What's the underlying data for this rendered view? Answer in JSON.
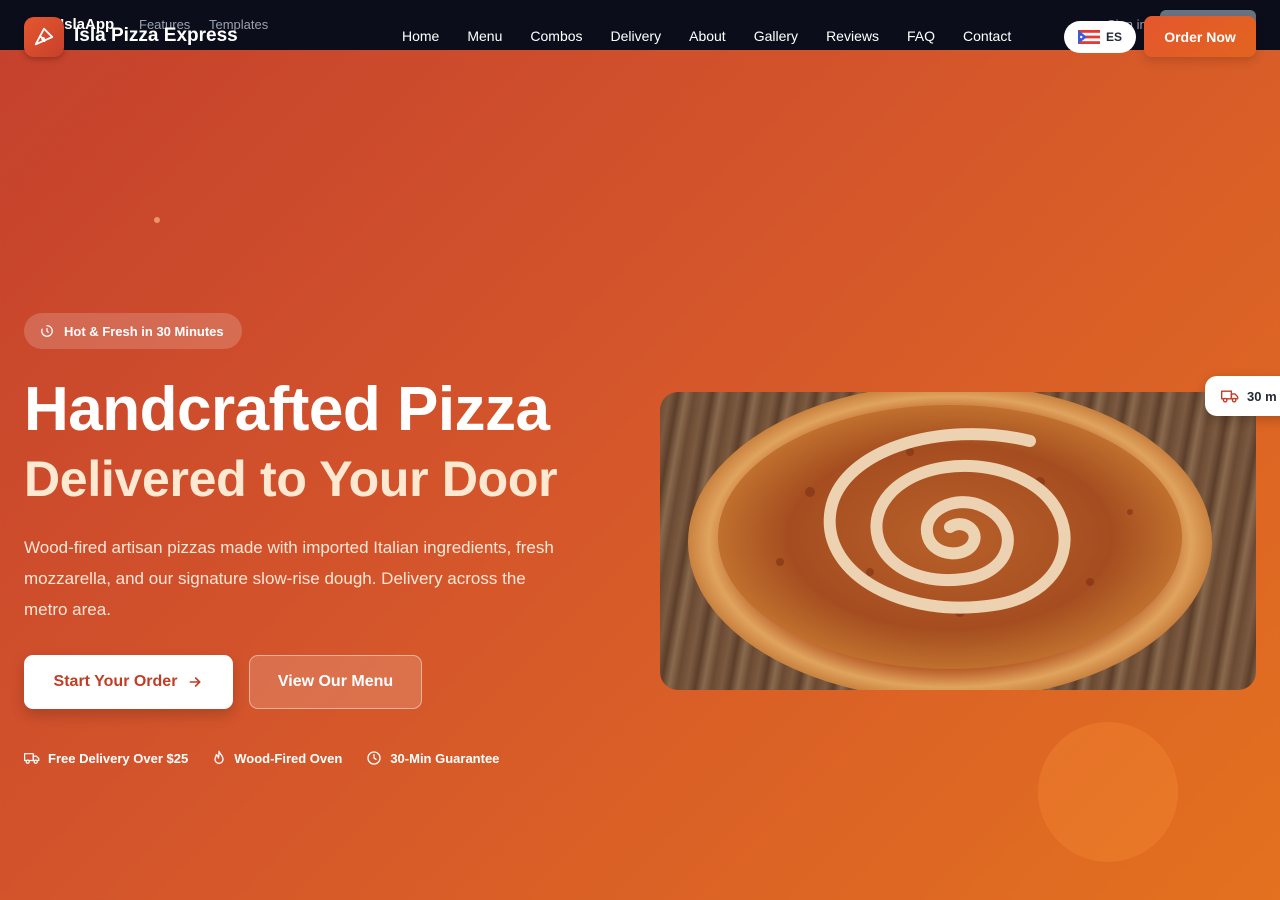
{
  "background_app": {
    "logo": "IslaApp",
    "links": [
      "Features",
      "Templates"
    ],
    "signin": "Sign in"
  },
  "brand": {
    "name": "Isla Pizza Express",
    "logo_icon": "pizza-slice-icon"
  },
  "nav": {
    "links": [
      "Home",
      "Menu",
      "Combos",
      "Delivery",
      "About",
      "Gallery",
      "Reviews",
      "FAQ",
      "Contact"
    ],
    "language": "ES",
    "language_flag": "puerto-rico-flag-icon",
    "order_button": "Order Now"
  },
  "hero": {
    "badge": "Hot & Fresh in 30 Minutes",
    "title": "Handcrafted Pizza",
    "subtitle": "Delivered to Your Door",
    "description": "Wood-fired artisan pizzas made with imported Italian ingredients, fresh mozzarella, and our signature slow-rise dough. Delivery across the metro area.",
    "primary_cta": "Start Your Order",
    "secondary_cta": "View Our Menu",
    "features": [
      {
        "icon": "truck-icon",
        "label": "Free Delivery Over $25"
      },
      {
        "icon": "flame-icon",
        "label": "Wood-Fired Oven"
      },
      {
        "icon": "clock-icon",
        "label": "30-Min Guarantee"
      }
    ],
    "delivery_chip": "30 m"
  },
  "colors": {
    "gradient_start": "#c4402d",
    "gradient_end": "#e3711f",
    "primary_text": "#c13d26",
    "subtitle": "#fde8d1"
  }
}
